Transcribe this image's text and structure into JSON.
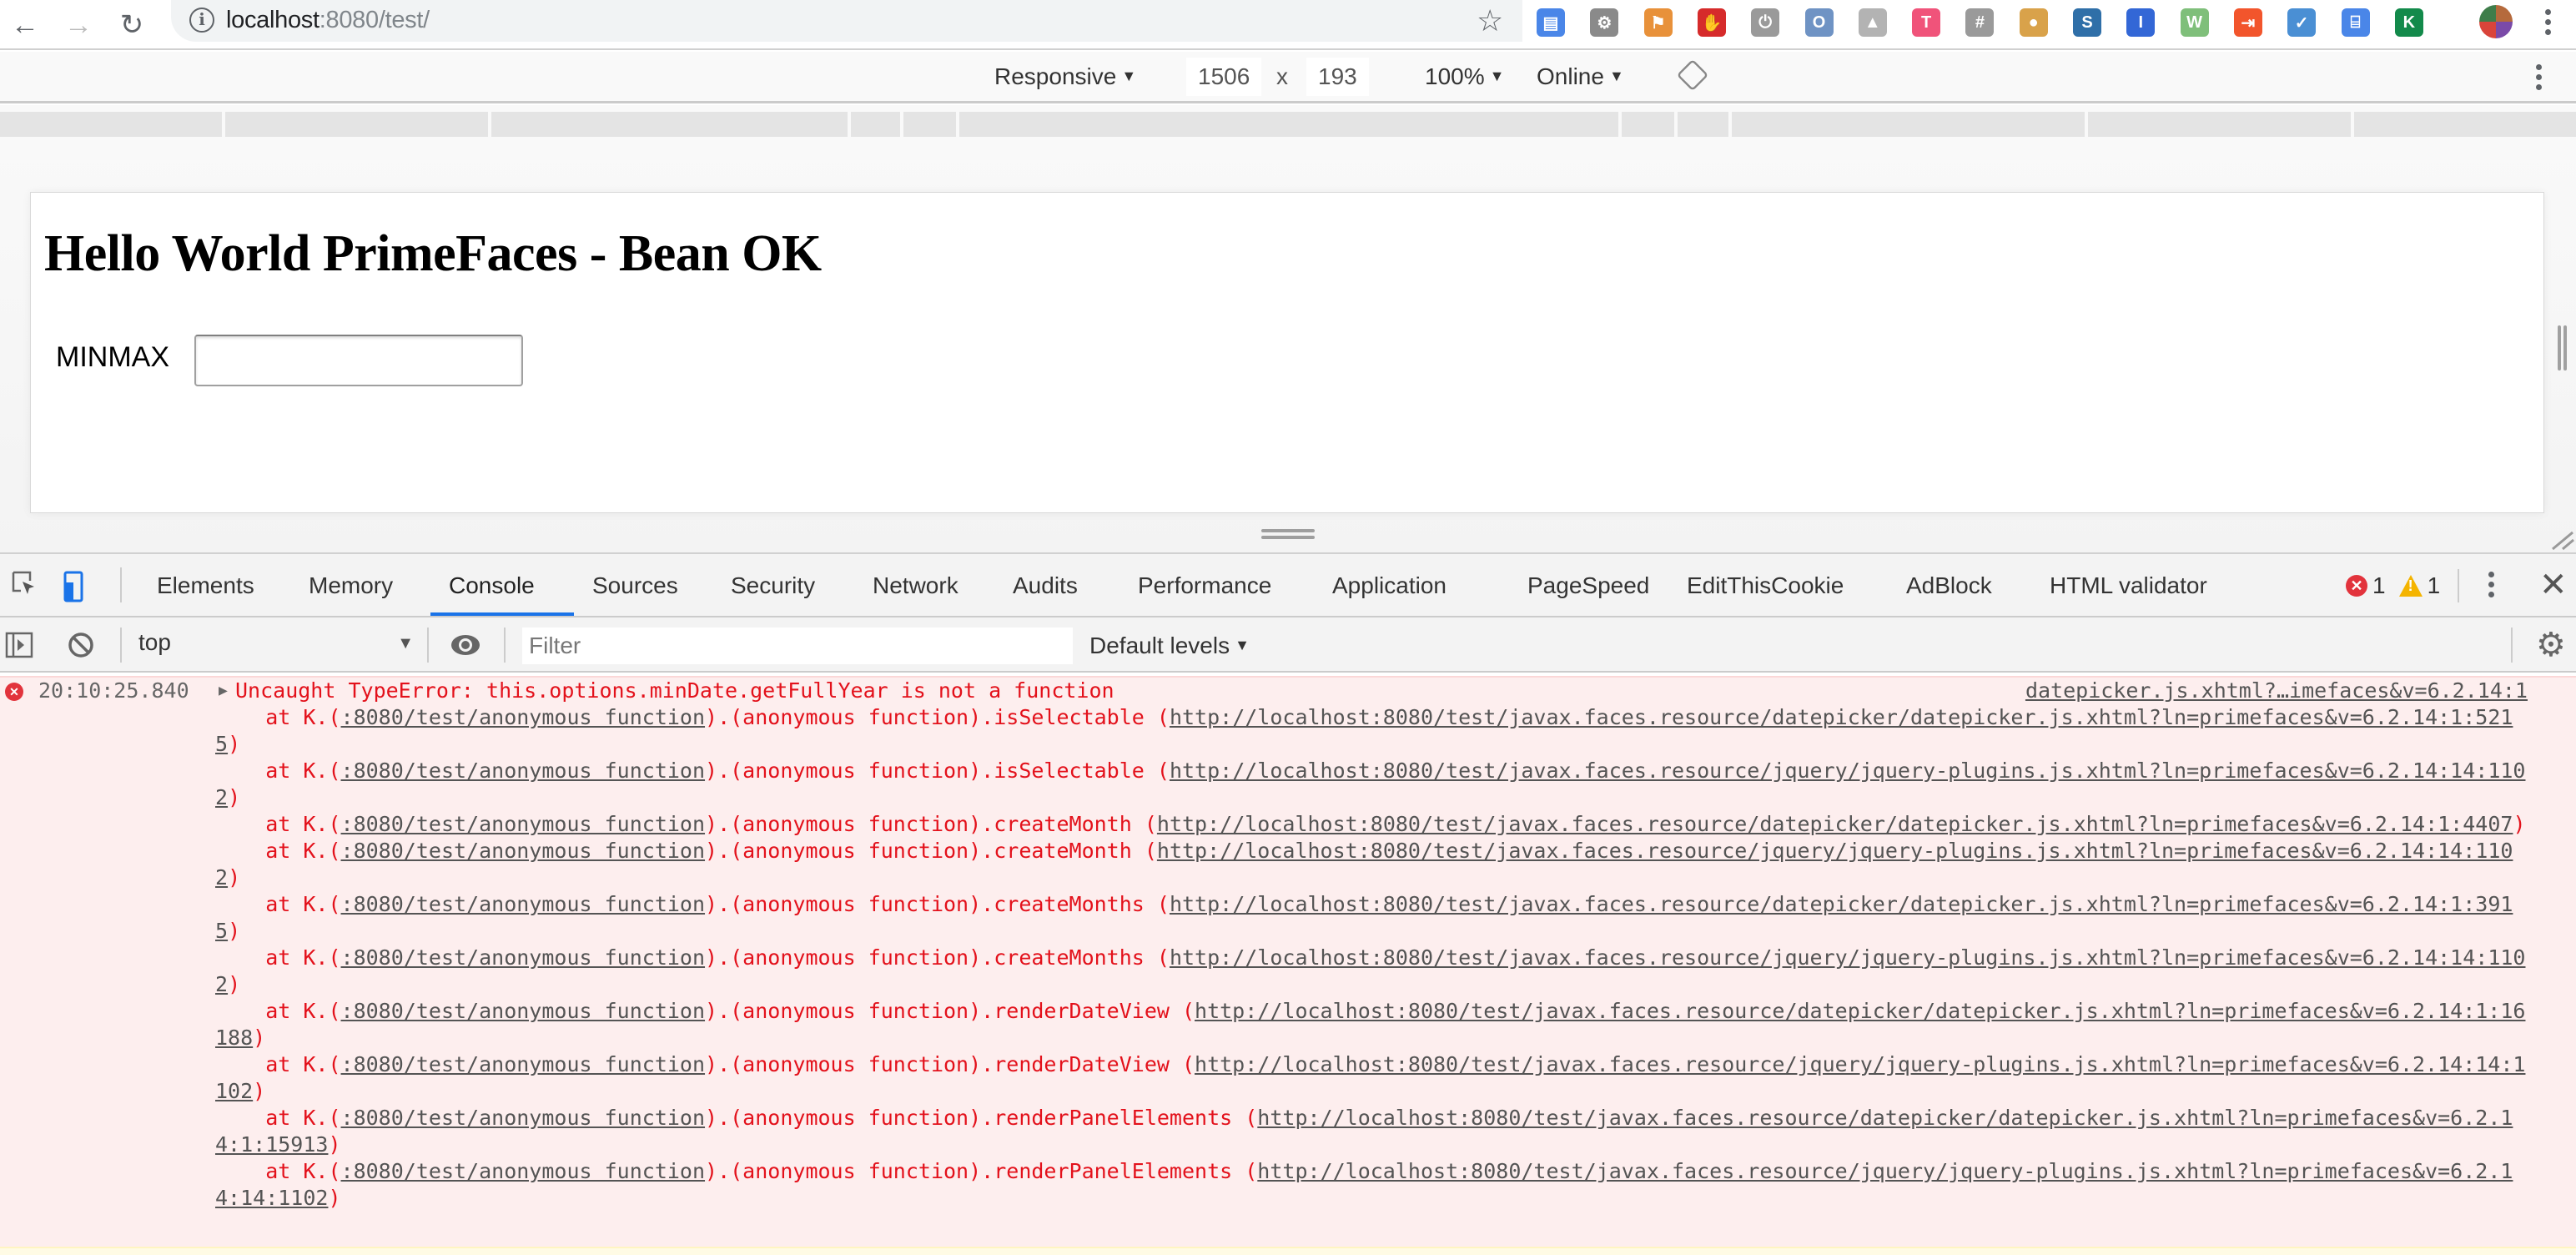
{
  "browser": {
    "url_host": "localhost",
    "url_rest": ":8080/test/",
    "extensions": [
      {
        "name": "pagespeed-extension-icon",
        "color": "#4a86e8",
        "glyph": "▤"
      },
      {
        "name": "settings-gear-extension-icon",
        "color": "#8a8a8a",
        "glyph": "⚙"
      },
      {
        "name": "flag-extension-icon",
        "color": "#e8913a",
        "glyph": "⚑"
      },
      {
        "name": "adblock-extension-icon",
        "color": "#d62b2b",
        "glyph": "✋"
      },
      {
        "name": "power-extension-icon",
        "color": "#9a9a9a",
        "glyph": "⏻"
      },
      {
        "name": "json-viewer-extension-icon",
        "color": "#6f93c4",
        "glyph": "O"
      },
      {
        "name": "drive-extension-icon",
        "color": "#b3b3b3",
        "glyph": "▲"
      },
      {
        "name": "toggl-extension-icon",
        "color": "#f0537a",
        "glyph": "T"
      },
      {
        "name": "hashtag-extension-icon",
        "color": "#9a9a9a",
        "glyph": "#"
      },
      {
        "name": "cookie-extension-icon",
        "color": "#d9a24a",
        "glyph": "●"
      },
      {
        "name": "s-extension-icon",
        "color": "#2f6fa8",
        "glyph": "S"
      },
      {
        "name": "lighthouse-extension-icon",
        "color": "#3367d6",
        "glyph": "I"
      },
      {
        "name": "w-extension-icon",
        "color": "#7fbf7a",
        "glyph": "W"
      },
      {
        "name": "red-arrow-extension-icon",
        "color": "#f2552c",
        "glyph": "⇥"
      },
      {
        "name": "checkmark-extension-icon",
        "color": "#4a8fd4",
        "glyph": "✓"
      },
      {
        "name": "tag-extension-icon",
        "color": "#4a86e8",
        "glyph": "⌸"
      },
      {
        "name": "k-extension-icon",
        "color": "#138a4b",
        "glyph": "K"
      }
    ]
  },
  "device_toolbar": {
    "device": "Responsive",
    "width": "1506",
    "times": "x",
    "height": "193",
    "zoom": "100%",
    "throttling": "Online"
  },
  "page": {
    "title": "Hello World PrimeFaces - Bean OK",
    "field_label": "MINMAX",
    "field_value": ""
  },
  "devtools": {
    "tabs": [
      "Elements",
      "Memory",
      "Console",
      "Sources",
      "Security",
      "Network",
      "Audits",
      "Performance",
      "Application",
      "PageSpeed",
      "EditThisCookie",
      "AdBlock",
      "HTML validator"
    ],
    "active_tab": "Console",
    "error_count": "1",
    "warning_count": "1",
    "context": "top",
    "filter_placeholder": "Filter",
    "levels": "Default levels"
  },
  "console": {
    "error": {
      "timestamp": "20:10:25.840",
      "message": "Uncaught TypeError: this.options.minDate.getFullYear is not a function",
      "source": "datepicker.js.xhtml?…imefaces&v=6.2.14:1",
      "stack": [
        {
          "prefix": "    at K.(",
          "loc": ":8080/test/anonymous function",
          "mid": ").(anonymous function).isSelectable (",
          "url": "http://localhost:8080/test/javax.faces.resource/datepicker/datepicker.js.xhtml?ln=primefaces&v=6.2.14:1:5215",
          "suffix": ")"
        },
        {
          "prefix": "    at K.(",
          "loc": ":8080/test/anonymous function",
          "mid": ").(anonymous function).isSelectable (",
          "url": "http://localhost:8080/test/javax.faces.resource/jquery/jquery-plugins.js.xhtml?ln=primefaces&v=6.2.14:14:1102",
          "suffix": ")"
        },
        {
          "prefix": "    at K.(",
          "loc": ":8080/test/anonymous function",
          "mid": ").(anonymous function).createMonth (",
          "url": "http://localhost:8080/test/javax.faces.resource/datepicker/datepicker.js.xhtml?ln=primefaces&v=6.2.14:1:4407",
          "suffix": ")"
        },
        {
          "prefix": "    at K.(",
          "loc": ":8080/test/anonymous function",
          "mid": ").(anonymous function).createMonth (",
          "url": "http://localhost:8080/test/javax.faces.resource/jquery/jquery-plugins.js.xhtml?ln=primefaces&v=6.2.14:14:1102",
          "suffix": ")"
        },
        {
          "prefix": "    at K.(",
          "loc": ":8080/test/anonymous function",
          "mid": ").(anonymous function).createMonths (",
          "url": "http://localhost:8080/test/javax.faces.resource/datepicker/datepicker.js.xhtml?ln=primefaces&v=6.2.14:1:3915",
          "suffix": ")"
        },
        {
          "prefix": "    at K.(",
          "loc": ":8080/test/anonymous function",
          "mid": ").(anonymous function).createMonths (",
          "url": "http://localhost:8080/test/javax.faces.resource/jquery/jquery-plugins.js.xhtml?ln=primefaces&v=6.2.14:14:1102",
          "suffix": ")"
        },
        {
          "prefix": "    at K.(",
          "loc": ":8080/test/anonymous function",
          "mid": ").(anonymous function).renderDateView (",
          "url": "http://localhost:8080/test/javax.faces.resource/datepicker/datepicker.js.xhtml?ln=primefaces&v=6.2.14:1:16188",
          "suffix": ")"
        },
        {
          "prefix": "    at K.(",
          "loc": ":8080/test/anonymous function",
          "mid": ").(anonymous function).renderDateView (",
          "url": "http://localhost:8080/test/javax.faces.resource/jquery/jquery-plugins.js.xhtml?ln=primefaces&v=6.2.14:14:1102",
          "suffix": ")"
        },
        {
          "prefix": "    at K.(",
          "loc": ":8080/test/anonymous function",
          "mid": ").(anonymous function).renderPanelElements (",
          "url": "http://localhost:8080/test/javax.faces.resource/datepicker/datepicker.js.xhtml?ln=primefaces&v=6.2.14:1:15913",
          "suffix": ")"
        },
        {
          "prefix": "    at K.(",
          "loc": ":8080/test/anonymous function",
          "mid": ").(anonymous function).renderPanelElements (",
          "url": "http://localhost:8080/test/javax.faces.resource/jquery/jquery-plugins.js.xhtml?ln=primefaces&v=6.2.14:14:1102",
          "suffix": ")"
        }
      ]
    }
  },
  "colors": {
    "error_red": "#e3111b",
    "error_bg": "#fdeeee",
    "active_tab_underline": "#1a73e8",
    "warning_yellow": "#f4b400"
  }
}
